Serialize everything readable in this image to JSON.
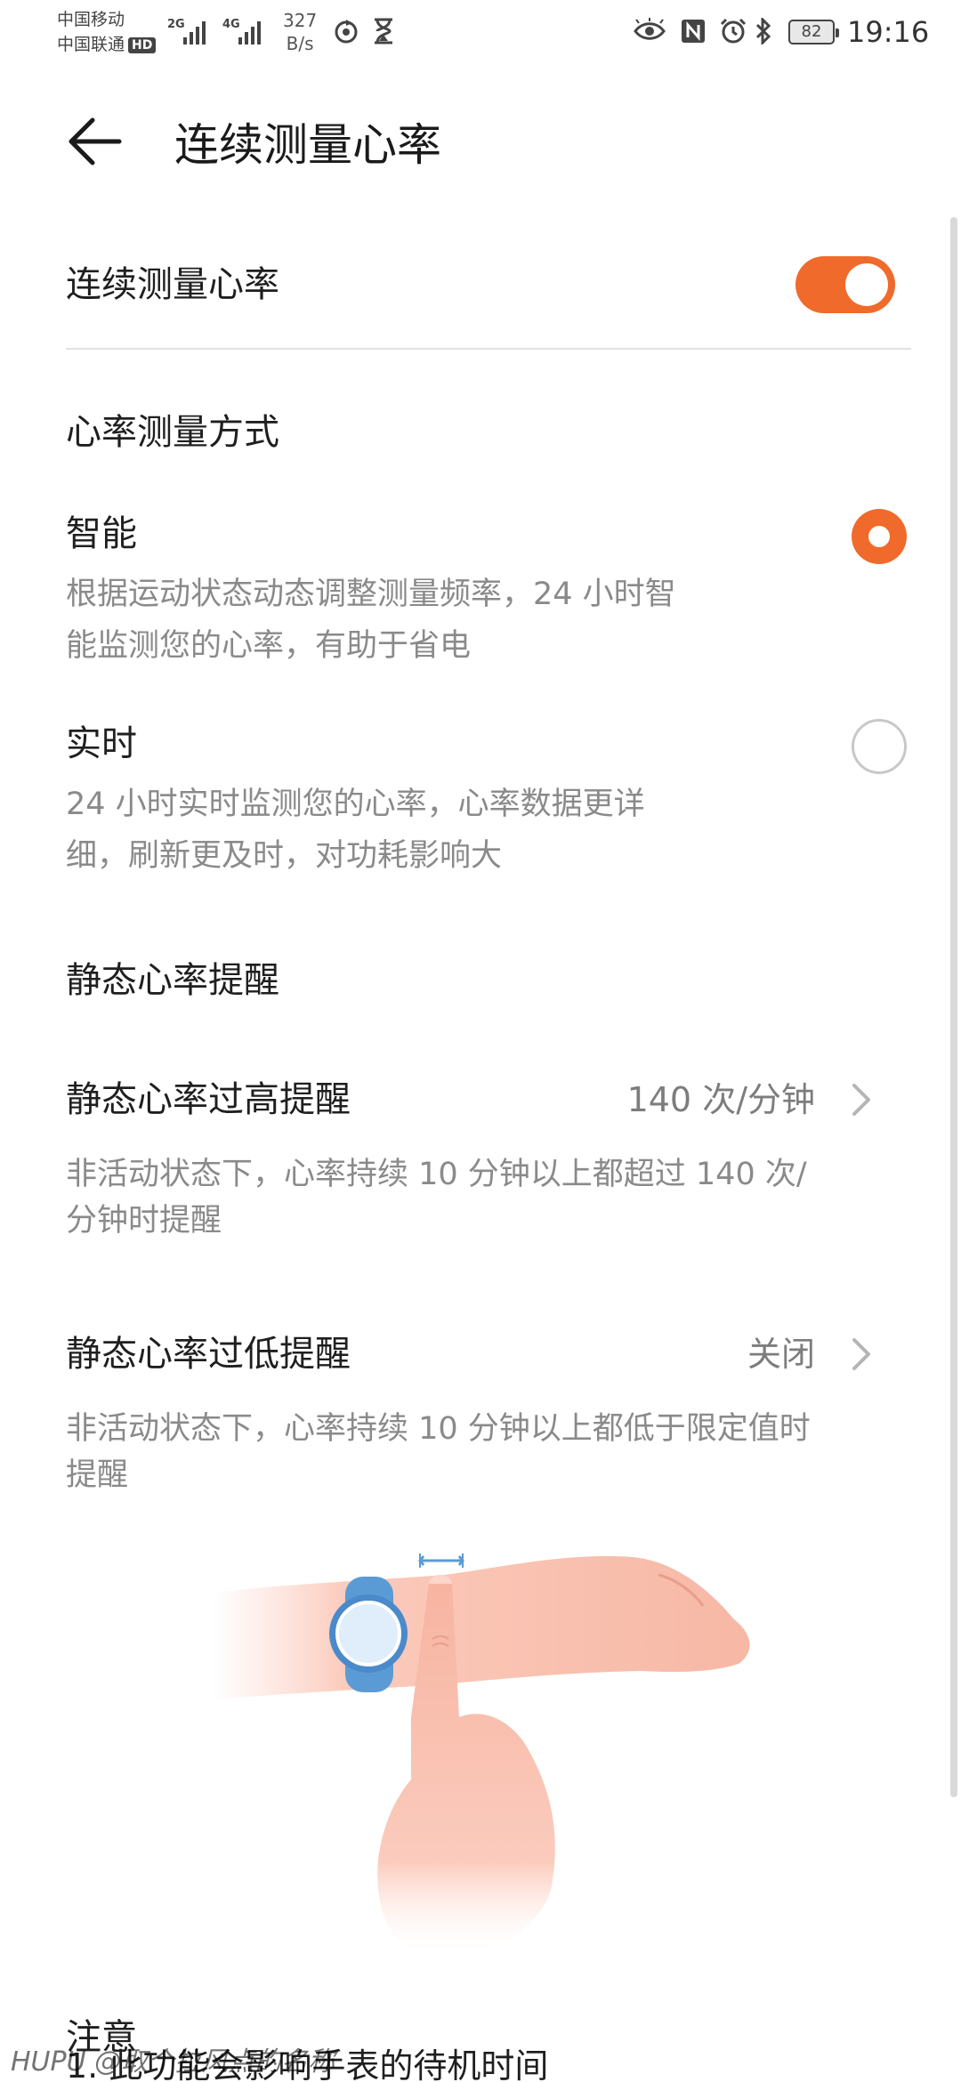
{
  "status_bar": {
    "carrier1": "中国移动",
    "carrier2": "中国联通",
    "hd_badge": "HD",
    "sig1_tag": "2G",
    "sig2_tag": "4G",
    "net_speed_value": "327",
    "net_speed_unit": "B/s",
    "battery": "82",
    "time": "19:16",
    "icons": [
      "sync-icon",
      "hourglass-icon",
      "eye-icon",
      "nfc-icon",
      "alarm-icon",
      "bluetooth-icon"
    ]
  },
  "header": {
    "title": "连续测量心率"
  },
  "continuous": {
    "label": "连续测量心率",
    "enabled": true
  },
  "mode_section": {
    "heading": "心率测量方式",
    "options": [
      {
        "title": "智能",
        "desc_line1": "根据运动状态动态调整测量频率，24 小时智",
        "desc_line2": "能监测您的心率，有助于省电",
        "selected": true
      },
      {
        "title": "实时",
        "desc_line1": "24 小时实时监测您的心率，心率数据更详",
        "desc_line2": "细，刷新更及时，对功耗影响大",
        "selected": false
      }
    ]
  },
  "alert_section": {
    "heading": "静态心率提醒",
    "items": [
      {
        "title": "静态心率过高提醒",
        "value": "140 次/分钟",
        "desc_line1": "非活动状态下，心率持续 10 分钟以上都超过 140 次/",
        "desc_line2": "分钟时提醒"
      },
      {
        "title": "静态心率过低提醒",
        "value": "关闭",
        "desc_line1": "非活动状态下，心率持续 10 分钟以上都低于限定值时",
        "desc_line2": "提醒"
      }
    ]
  },
  "note": {
    "heading": "注意",
    "line1": "1. 此功能会影响手表的待机时间"
  },
  "watermark": "HUPU @取个拉风点的名称",
  "colors": {
    "accent": "#f06a2b",
    "watch_band": "#5b9bd5",
    "skin": "#f8b9a6"
  }
}
